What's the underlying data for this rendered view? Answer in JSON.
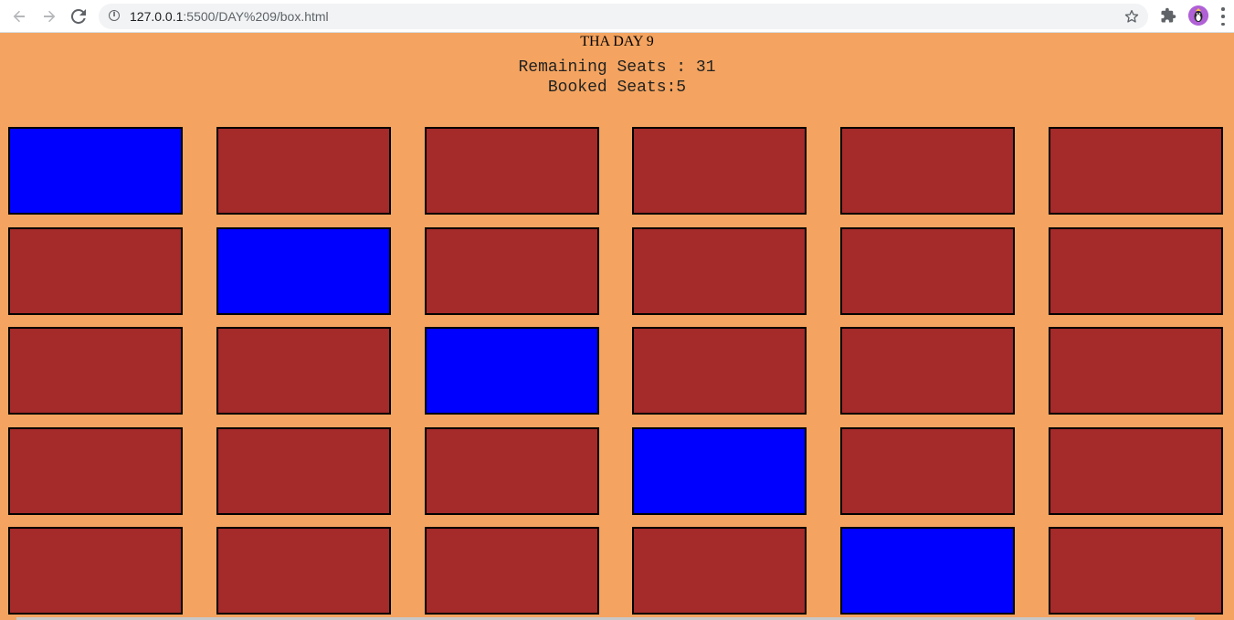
{
  "browser": {
    "url_host": "127.0.0.1",
    "url_path": ":5500/DAY%209/box.html",
    "icons": {
      "back": "back-arrow-icon",
      "forward": "forward-arrow-icon",
      "reload": "reload-icon",
      "info": "info-icon",
      "bookmark": "star-icon",
      "extensions": "puzzle-icon",
      "profile": "avatar",
      "menu": "kebab-menu-icon"
    }
  },
  "page": {
    "title": "THA DAY 9",
    "remaining_label": "Remaining Seats : 31",
    "booked_label": "Booked Seats:5",
    "colors": {
      "background": "#f4a460",
      "available": "#a52a2a",
      "booked": "#0000ff"
    }
  },
  "seats": [
    "booked",
    "available",
    "available",
    "available",
    "available",
    "available",
    "available",
    "booked",
    "available",
    "available",
    "available",
    "available",
    "available",
    "available",
    "booked",
    "available",
    "available",
    "available",
    "available",
    "available",
    "available",
    "booked",
    "available",
    "available",
    "available",
    "available",
    "available",
    "available",
    "booked",
    "available"
  ]
}
